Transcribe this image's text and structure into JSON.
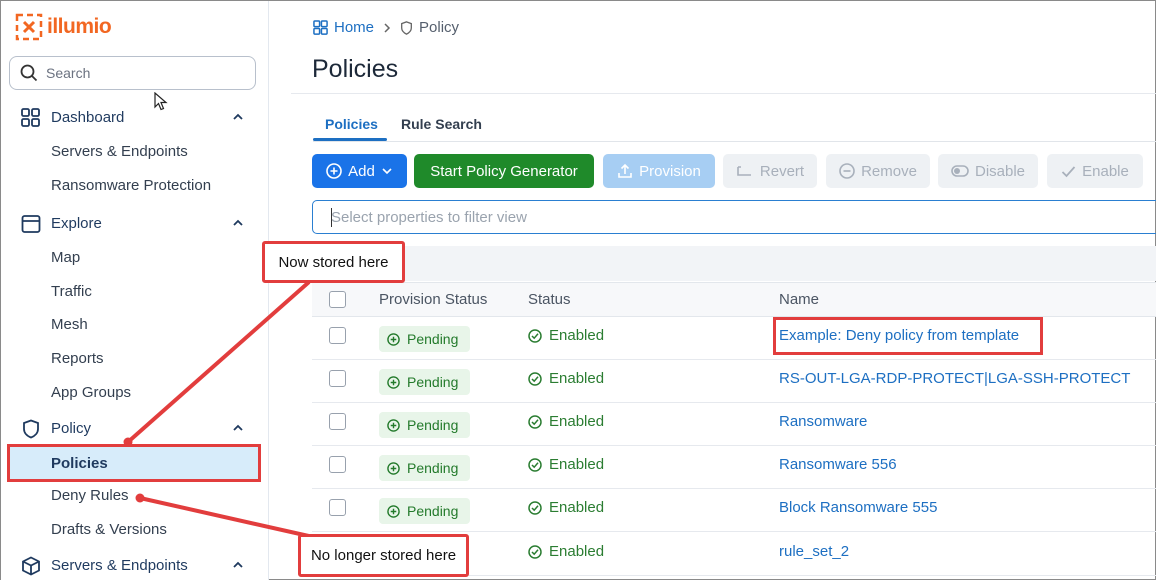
{
  "sidebar": {
    "logo_text": "illumio",
    "search_placeholder": "Search",
    "sections": [
      {
        "label": "Dashboard",
        "items": [
          "Servers & Endpoints",
          "Ransomware Protection"
        ]
      },
      {
        "label": "Explore",
        "items": [
          "Map",
          "Traffic",
          "Mesh",
          "Reports",
          "App Groups"
        ]
      },
      {
        "label": "Policy",
        "items": [
          "Policies",
          "Deny Rules",
          "Drafts & Versions"
        ]
      },
      {
        "label": "Servers & Endpoints",
        "items": []
      }
    ],
    "active_item": "Policies"
  },
  "breadcrumb": {
    "home": "Home",
    "current": "Policy"
  },
  "page_title": "Policies",
  "tabs": [
    {
      "label": "Policies",
      "active": true
    },
    {
      "label": "Rule Search",
      "active": false
    }
  ],
  "toolbar": {
    "add": "Add",
    "generator": "Start Policy Generator",
    "provision": "Provision",
    "revert": "Revert",
    "remove": "Remove",
    "disable": "Disable",
    "enable": "Enable"
  },
  "filter_placeholder": "Select properties to filter view",
  "table": {
    "columns": [
      "Provision Status",
      "Status",
      "Name"
    ],
    "rows": [
      {
        "provision": "Pending",
        "status": "Enabled",
        "name": "Example: Deny policy from template"
      },
      {
        "provision": "Pending",
        "status": "Enabled",
        "name": "RS-OUT-LGA-RDP-PROTECT|LGA-SSH-PROTECT"
      },
      {
        "provision": "Pending",
        "status": "Enabled",
        "name": "Ransomware"
      },
      {
        "provision": "Pending",
        "status": "Enabled",
        "name": "Ransomware 556"
      },
      {
        "provision": "Pending",
        "status": "Enabled",
        "name": "Block Ransomware 555"
      },
      {
        "provision": "",
        "status": "Enabled",
        "name": "rule_set_2"
      }
    ]
  },
  "annotations": {
    "now_stored": "Now stored here",
    "no_longer": "No longer stored here"
  },
  "colors": {
    "accent": "#1a73e8",
    "success": "#1f8a2a",
    "brand": "#f26722",
    "callout": "#e23d3d"
  }
}
